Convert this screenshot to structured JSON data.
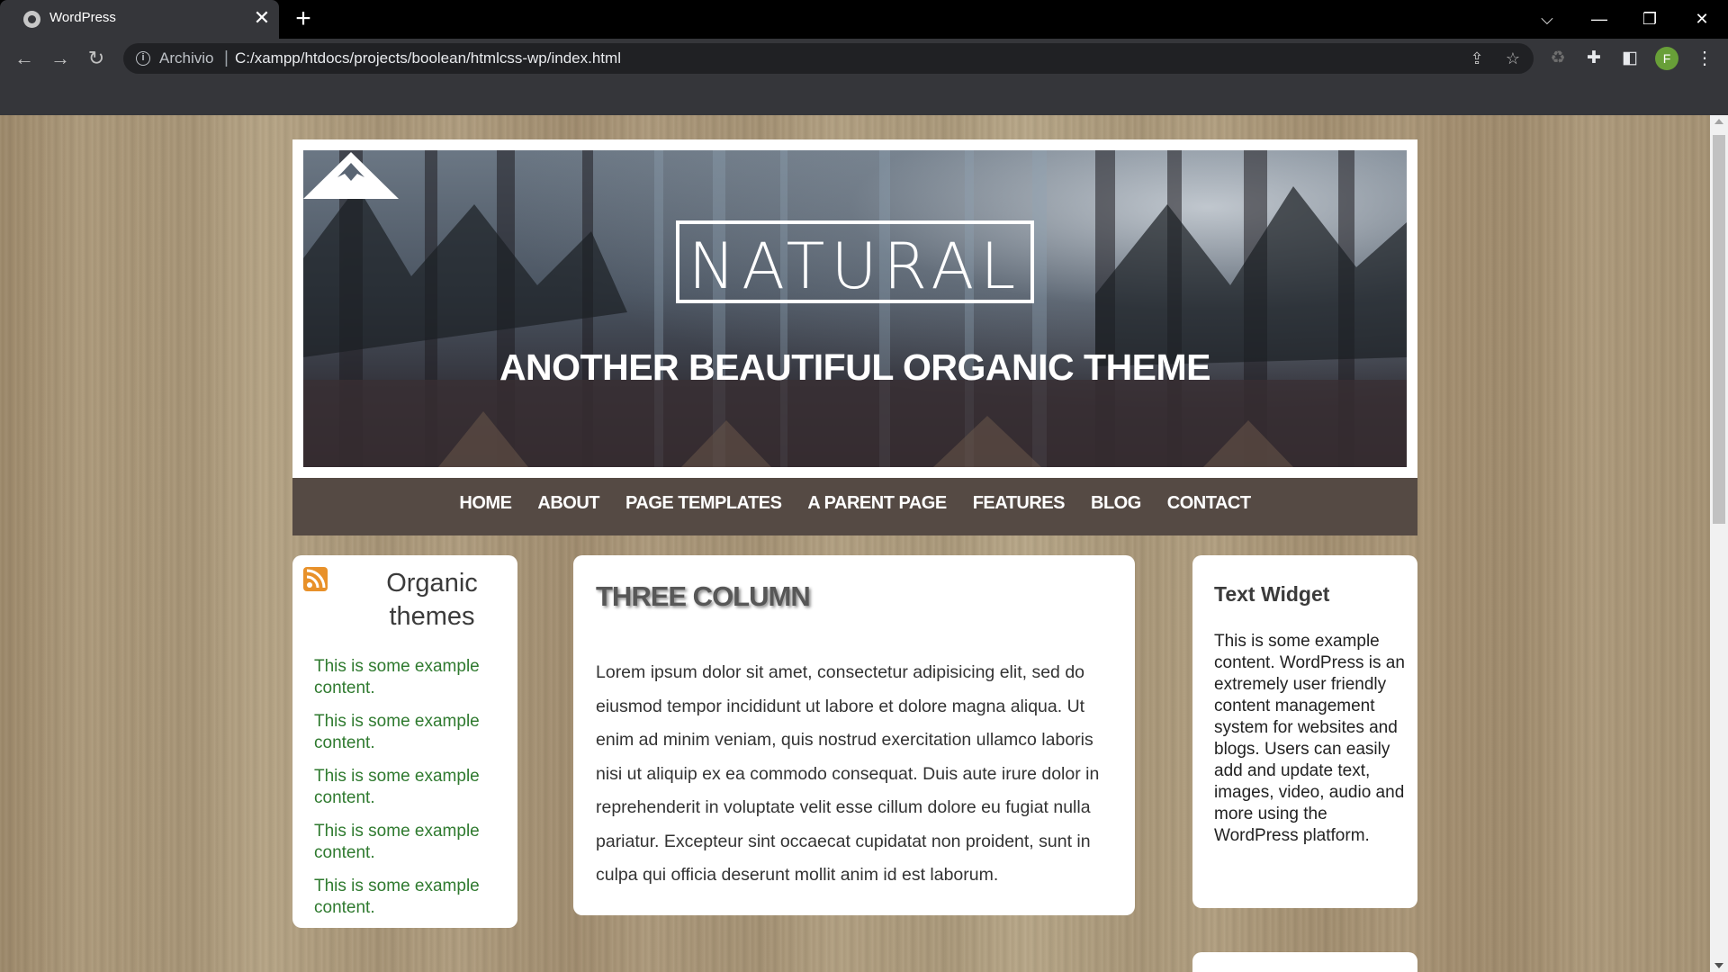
{
  "browser": {
    "tab_title": "WordPress",
    "tab_close": "✕",
    "new_tab": "+",
    "omnibox_chip": "Archivio",
    "omnibox_separator": "|",
    "url": "C:/xampp/htdocs/projects/boolean/htmlcss-wp/index.html",
    "profile_initial": "F",
    "profile_color": "#689f38"
  },
  "site": {
    "logo_text": "NATURAL",
    "tagline": "ANOTHER BEAUTIFUL ORGANIC THEME",
    "nav": [
      "HOME",
      "ABOUT",
      "PAGE TEMPLATES",
      "A PARENT PAGE",
      "FEATURES",
      "BLOG",
      "CONTACT"
    ],
    "nav_background": "#554a44",
    "left_widget": {
      "title": "Organic themes",
      "icon": "rss-icon",
      "items": [
        "This is some example content.",
        "This is some example content.",
        "This is some example content.",
        "This is some example content.",
        "This is some example content."
      ],
      "item_color": "#2f7a2f"
    },
    "main": {
      "title": "THREE COLUMN",
      "body": "Lorem ipsum dolor sit amet, consectetur adipisicing elit, sed do eiusmod tempor incididunt ut labore et dolore magna aliqua. Ut enim ad minim veniam, quis nostrud exercitation ullamco laboris nisi ut aliquip ex ea commodo consequat. Duis aute irure dolor in reprehenderit in voluptate velit esse cillum dolore eu fugiat nulla pariatur. Excepteur sint occaecat cupidatat non proident, sunt in culpa qui officia deserunt mollit anim id est laborum."
    },
    "right_widget": {
      "title": "Text Widget",
      "body": "This is some example content. WordPress is an extremely user friendly content management system for websites and blogs. Users can easily add and update text, images, video, audio and more using the WordPress platform."
    }
  }
}
